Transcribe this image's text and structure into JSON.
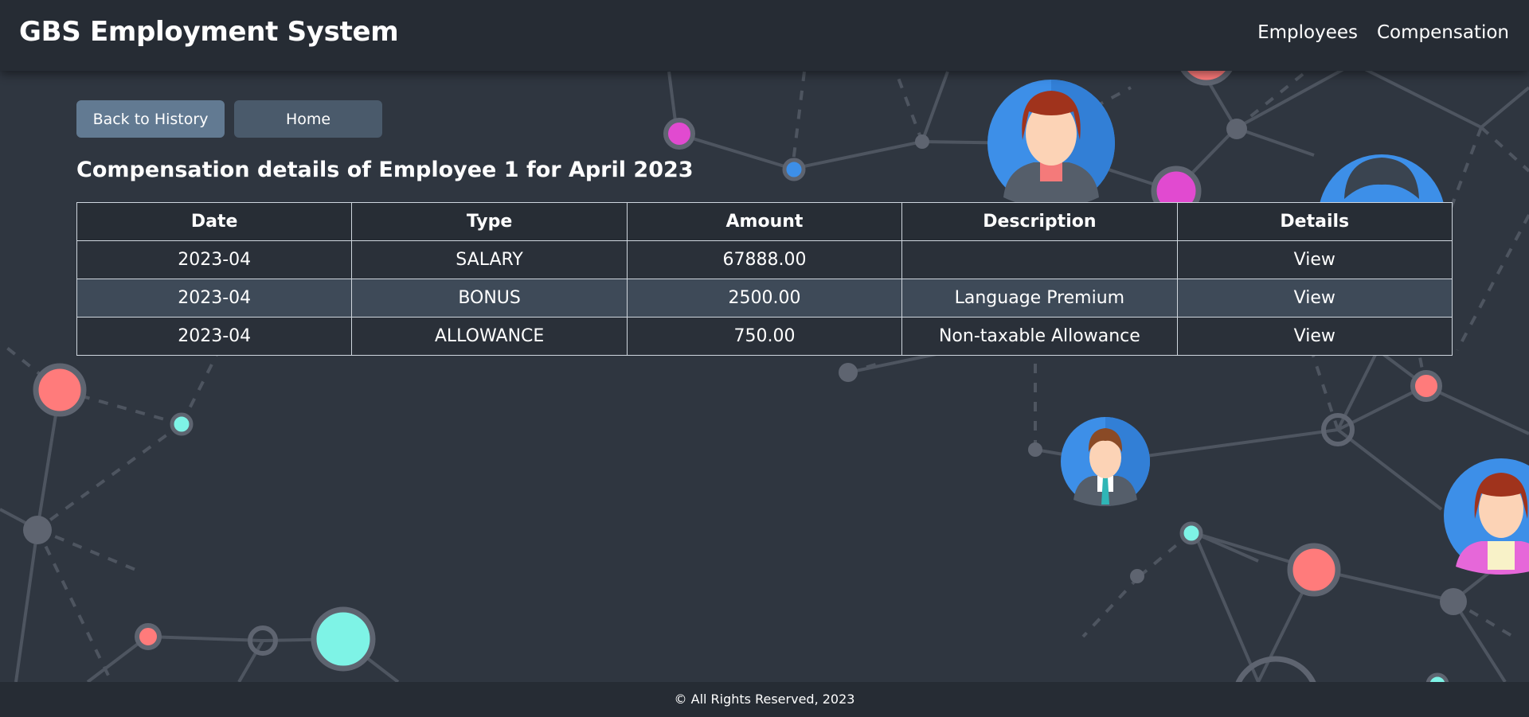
{
  "header": {
    "title": "GBS Employment System",
    "nav": [
      "Employees",
      "Compensation"
    ]
  },
  "buttons": {
    "back": "Back to History",
    "home": "Home"
  },
  "page_title": "Compensation details of Employee 1 for April 2023",
  "table": {
    "columns": [
      "Date",
      "Type",
      "Amount",
      "Description",
      "Details"
    ],
    "rows": [
      {
        "date": "2023-04",
        "type": "SALARY",
        "amount": "67888.00",
        "description": "",
        "details": "View"
      },
      {
        "date": "2023-04",
        "type": "BONUS",
        "amount": "2500.00",
        "description": "Language Premium",
        "details": "View"
      },
      {
        "date": "2023-04",
        "type": "ALLOWANCE",
        "amount": "750.00",
        "description": "Non-taxable Allowance",
        "details": "View"
      }
    ]
  },
  "footer": "© All Rights Reserved, 2023",
  "colors": {
    "background": "#2f3640",
    "header": "#262c34",
    "accent_pink": "#e14ad0",
    "accent_coral": "#ff7b7b",
    "accent_teal": "#7ef3e6",
    "accent_blue": "#3d8fe8"
  }
}
